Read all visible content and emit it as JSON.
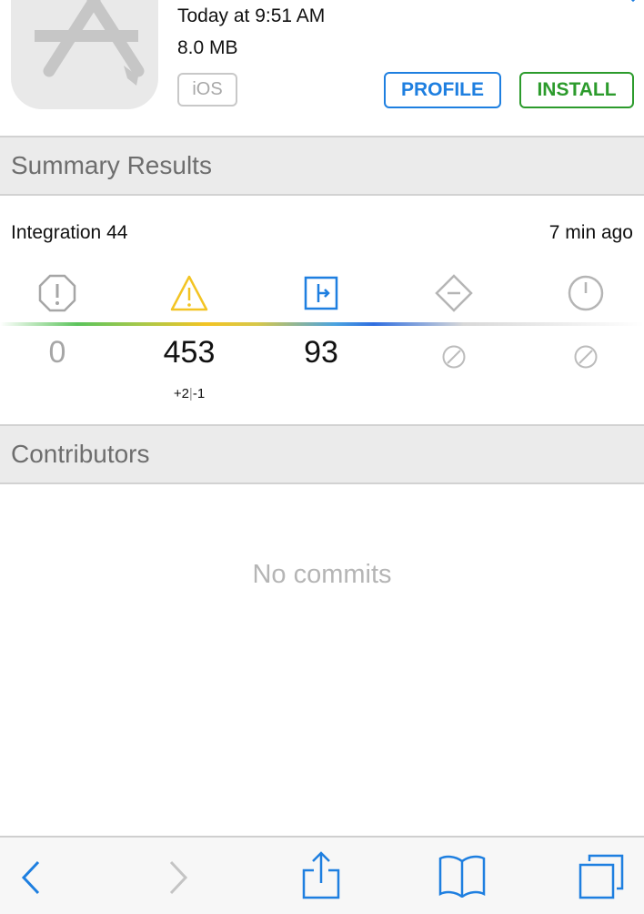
{
  "header": {
    "date": "Today at 9:51 AM",
    "size": "8.0 MB",
    "platform": "iOS",
    "profile_label": "PROFILE",
    "install_label": "INSTALL"
  },
  "summary": {
    "title": "Summary Results",
    "integration": "Integration 44",
    "time_ago": "7 min ago",
    "metrics": {
      "errors": "0",
      "warnings": "453",
      "warnings_delta_plus": "+2",
      "warnings_delta_sep": "|",
      "warnings_delta_minus": "-1",
      "analyzer": "93"
    },
    "icons": [
      "error-octagon-icon",
      "warning-triangle-icon",
      "analyzer-icon",
      "test-diamond-icon",
      "coverage-clock-icon"
    ],
    "colors": {
      "warning": "#f3c423",
      "analyzer": "#1e7fe0",
      "error": "#a6a6a6"
    }
  },
  "contributors": {
    "title": "Contributors",
    "empty_text": "No commits"
  },
  "colors": {
    "profile": "#1e7fe0",
    "install": "#2c9b2c"
  }
}
